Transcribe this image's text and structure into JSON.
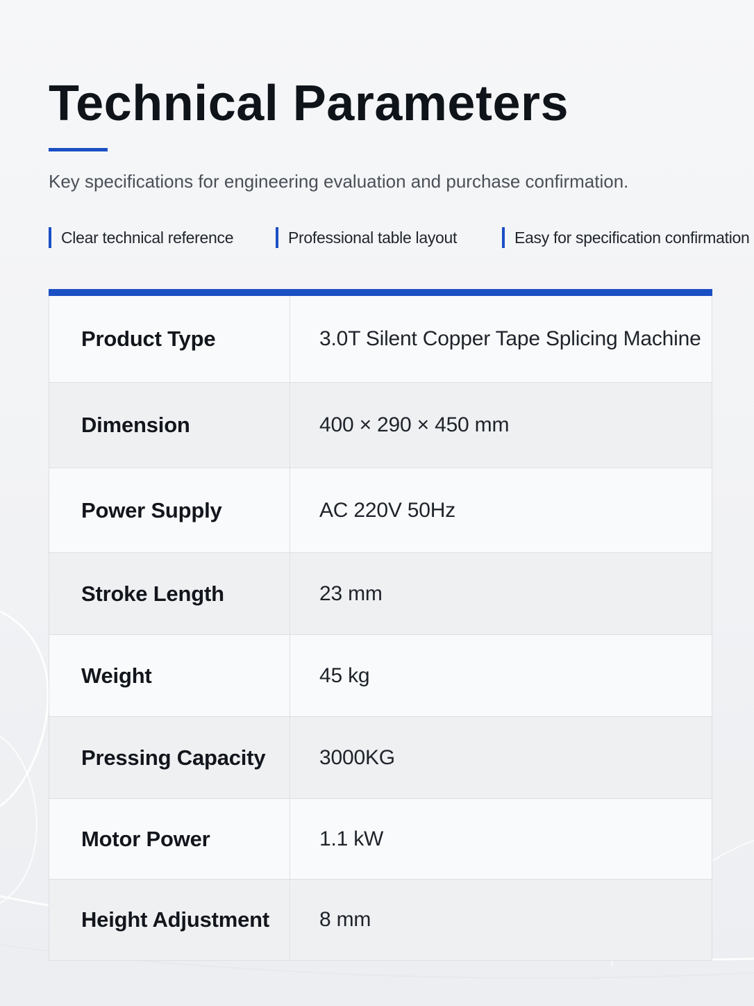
{
  "header": {
    "title": "Technical Parameters",
    "subtitle": "Key specifications for engineering evaluation and purchase confirmation."
  },
  "features": [
    {
      "label": "Clear technical reference"
    },
    {
      "label": "Professional table layout"
    },
    {
      "label": "Easy for specification confirmation"
    }
  ],
  "table": {
    "rows": [
      {
        "label": "Product Type",
        "value": "3.0T Silent Copper Tape Splicing Machine"
      },
      {
        "label": "Dimension",
        "value": "400 × 290 × 450 mm"
      },
      {
        "label": "Power Supply",
        "value": "AC 220V  50Hz"
      },
      {
        "label": "Stroke Length",
        "value": "23 mm"
      },
      {
        "label": "Weight",
        "value": "45 kg"
      },
      {
        "label": "Pressing Capacity",
        "value": "3000KG"
      },
      {
        "label": "Motor Power",
        "value": "1.1 kW"
      },
      {
        "label": "Height Adjustment",
        "value": "8 mm"
      }
    ]
  },
  "colors": {
    "accent": "#1b4fc4",
    "background": "#f3f4f6",
    "row_light": "#f9fafb",
    "row_shaded": "#eff0f2",
    "border": "#dcdfe4"
  }
}
